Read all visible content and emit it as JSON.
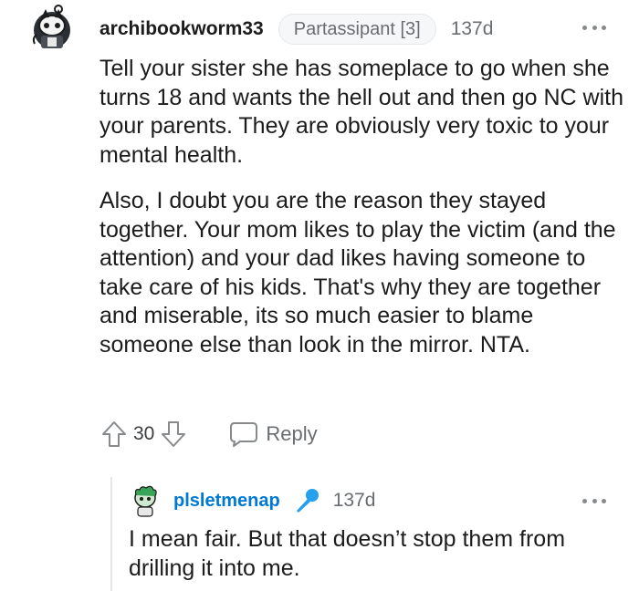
{
  "comment": {
    "username": "archibookworm33",
    "flair": "Partassipant [3]",
    "age": "137d",
    "paragraphs": [
      "Tell your sister she has someplace to go when she turns 18 and wants the hell out and then go NC with your parents. They are obviously very toxic to your mental health.",
      "Also, I doubt you are the reason they stayed together. Your mom likes to play the victim (and the attention) and your dad likes having someone to take care of his kids. That's why they are together and miserable, its so much easier to blame someone else than look in the mirror. NTA."
    ],
    "score": "30",
    "reply_label": "Reply",
    "icons": {
      "avatar": "snoo-avatar-icon",
      "upvote": "upvote-arrow-icon",
      "downvote": "downvote-arrow-icon",
      "reply": "speech-bubble-icon",
      "more": "more-options-icon"
    }
  },
  "reply": {
    "username": "plsletmenap",
    "age": "137d",
    "text": "I mean fair. But that doesn’t stop them from drilling it into me.",
    "icons": {
      "avatar": "snoo-avatar-icon",
      "badge": "microphone-icon",
      "more": "more-options-icon"
    }
  },
  "colors": {
    "username_link": "#0079d3",
    "meta_gray": "#6a6d70",
    "text": "#1c1c1c"
  }
}
